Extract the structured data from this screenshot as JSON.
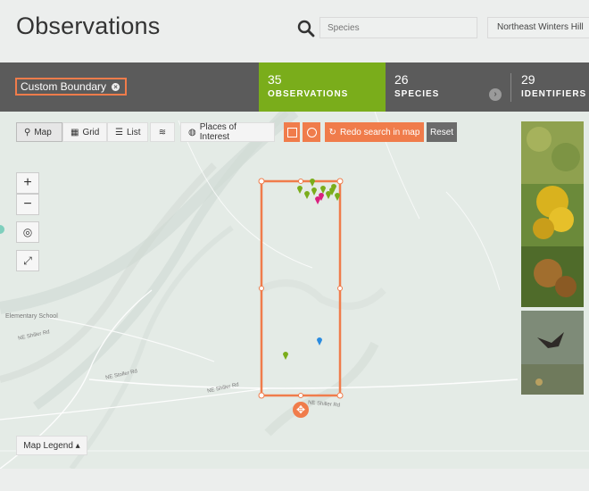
{
  "header": {
    "title": "Observations",
    "species_placeholder": "Species",
    "place_value": "Northeast Winters Hill"
  },
  "statsbar": {
    "boundary_label": "Custom Boundary",
    "observations": {
      "count": "35",
      "label": "OBSERVATIONS"
    },
    "species": {
      "count": "26",
      "label": "SPECIES"
    },
    "identifiers": {
      "count": "29",
      "label": "IDENTIFIERS"
    }
  },
  "toolbar": {
    "map": "Map",
    "grid": "Grid",
    "list": "List",
    "places": "Places of Interest",
    "redo": "Redo search in map",
    "reset": "Reset"
  },
  "map": {
    "zoom_in": "+",
    "zoom_out": "−",
    "legend": "Map Legend ▴",
    "labels": {
      "road1": "NE Shiller Rd",
      "road2": "NE Stoller Rd",
      "road3": "NE Shiller Rd",
      "road4": "NE Shiller Rd",
      "school": "Elementary School"
    }
  },
  "colors": {
    "accent": "#f07c4b",
    "observations_green": "#7aad1b",
    "statsbar": "#5b5b5b"
  },
  "icons": [
    "search-icon",
    "map-pin-icon",
    "grid-icon",
    "list-icon",
    "layers-icon",
    "globe-icon",
    "square-draw-icon",
    "circle-draw-icon",
    "refresh-icon",
    "close-icon",
    "arrow-right-icon",
    "locate-icon",
    "fullscreen-icon",
    "move-icon"
  ]
}
